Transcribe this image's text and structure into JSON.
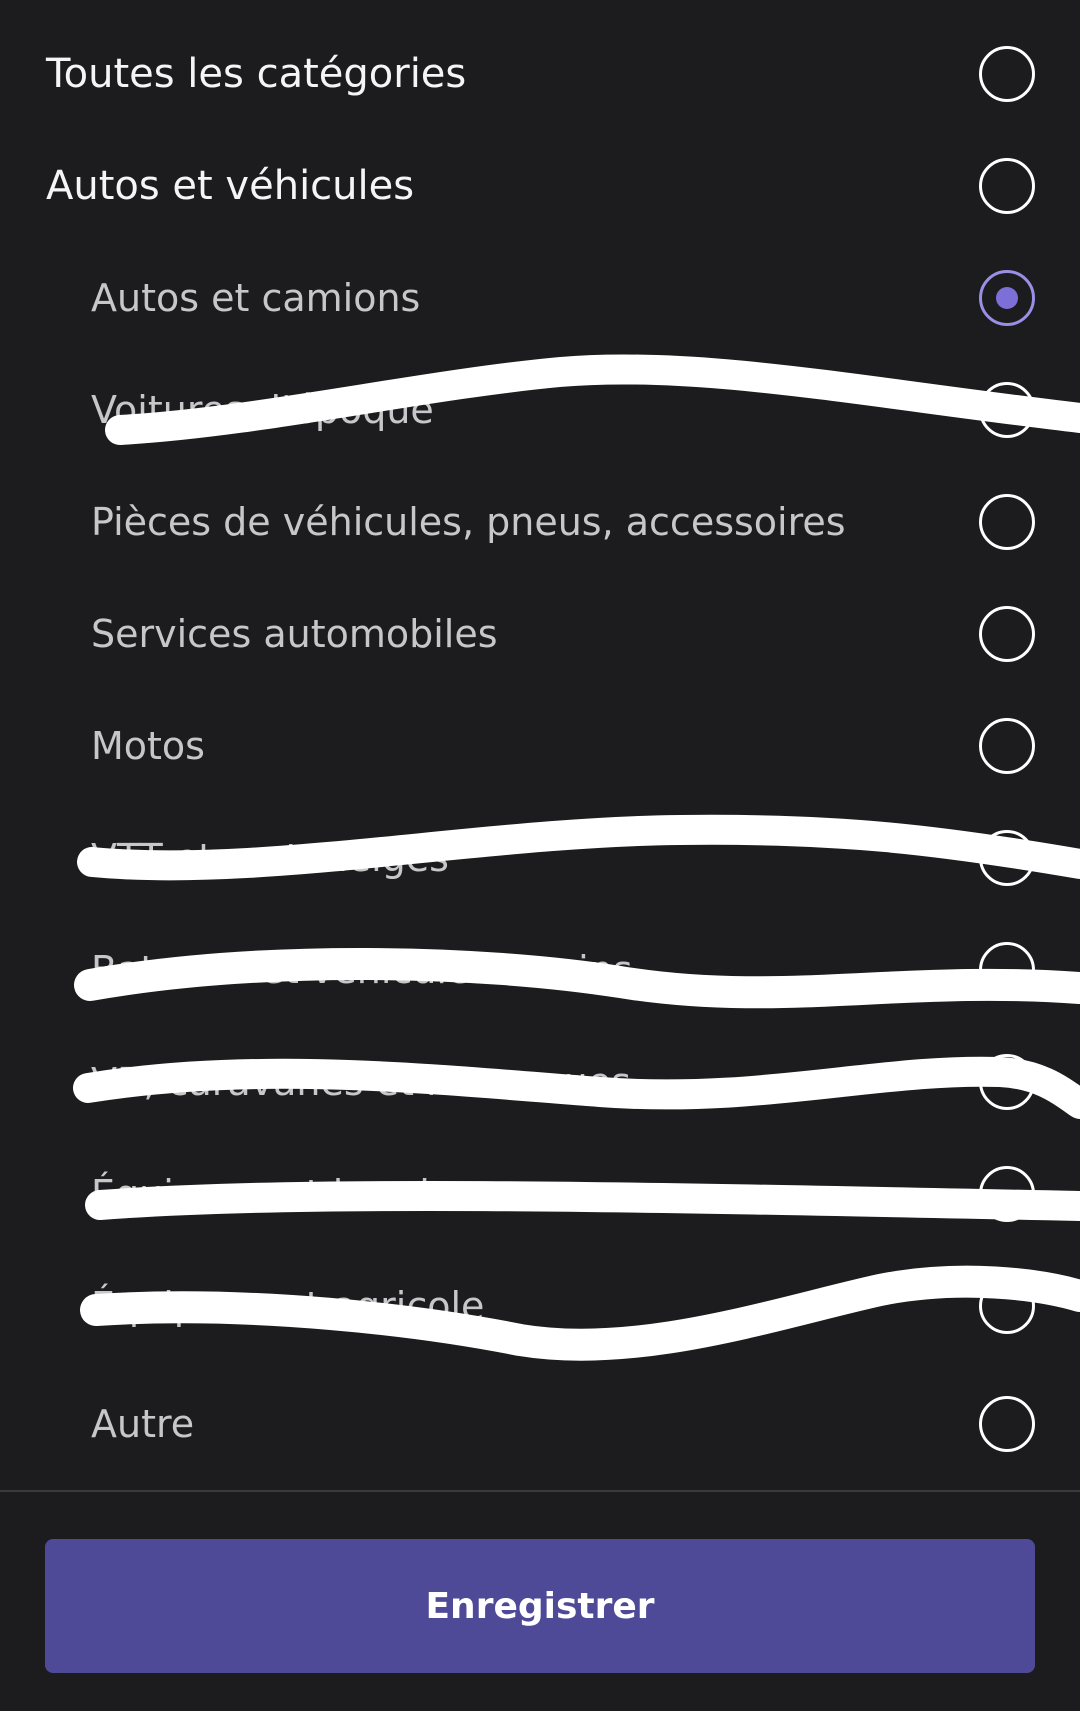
{
  "categories": [
    {
      "label": "Toutes les catégories",
      "level": "top",
      "selected": false
    },
    {
      "label": "Autos et véhicules",
      "level": "top",
      "selected": false
    },
    {
      "label": "Autos et camions",
      "level": "sub",
      "selected": true
    },
    {
      "label": "Voitures d'époque",
      "level": "sub",
      "selected": false
    },
    {
      "label": "Pièces de véhicules, pneus, accessoires",
      "level": "sub",
      "selected": false
    },
    {
      "label": "Services automobiles",
      "level": "sub",
      "selected": false
    },
    {
      "label": "Motos",
      "level": "sub",
      "selected": false
    },
    {
      "label": "VTT et motoneiges",
      "level": "sub",
      "selected": false
    },
    {
      "label": "Bateaux et véhicules marins",
      "level": "sub",
      "selected": false
    },
    {
      "label": "VR, caravanes et remorques",
      "level": "sub",
      "selected": false
    },
    {
      "label": "Équipement lourd",
      "level": "sub",
      "selected": false
    },
    {
      "label": "Équipement agricole",
      "level": "sub",
      "selected": false
    },
    {
      "label": "Autre",
      "level": "sub",
      "selected": false
    }
  ],
  "footer": {
    "save_label": "Enregistrer"
  },
  "colors": {
    "background": "#1c1c1e",
    "accent": "#4f4a98",
    "radio_selected": "#7c6fd8"
  }
}
